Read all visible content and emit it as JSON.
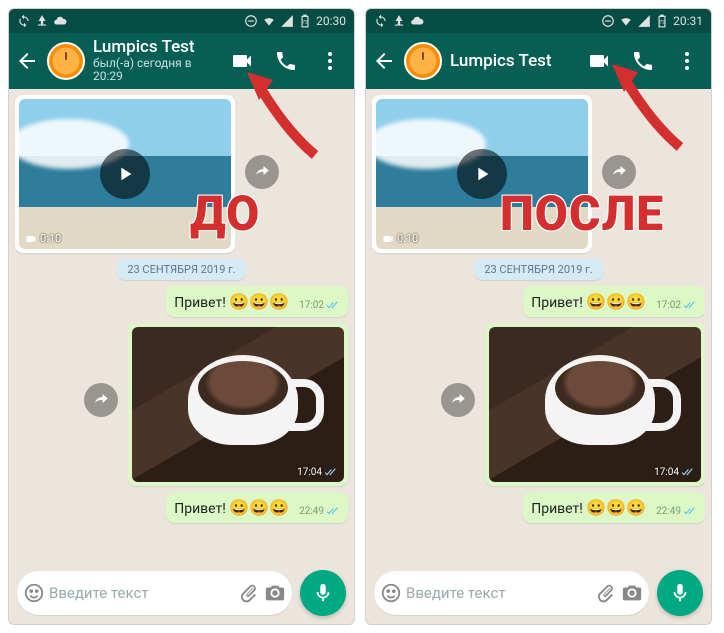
{
  "left": {
    "status_time": "20:30",
    "contact_name": "Lumpics Test",
    "last_seen": "был(-а) сегодня в 20:29",
    "overlay_label": "ДО",
    "video_duration": "0:10",
    "date_chip": "23 СЕНТЯБРЯ 2019 г.",
    "msg1_text": "Привет!",
    "msg1_emojis": "😀😀😀",
    "msg1_time": "17:02",
    "img_time": "17:04",
    "msg2_text": "Привет!",
    "msg2_emojis": "😀😀😀",
    "msg2_time": "22:49",
    "input_placeholder": "Введите текст"
  },
  "right": {
    "status_time": "20:31",
    "contact_name": "Lumpics Test",
    "last_seen": "",
    "overlay_label": "ПОСЛЕ",
    "video_duration": "0:10",
    "date_chip": "23 СЕНТЯБРЯ 2019 г.",
    "msg1_text": "Привет!",
    "msg1_emojis": "😀😀😀",
    "msg1_time": "17:02",
    "img_time": "17:04",
    "msg2_text": "Привет!",
    "msg2_emojis": "😀😀😀",
    "msg2_time": "22:49",
    "input_placeholder": "Введите текст"
  },
  "icons": {
    "back": "back-icon",
    "video_call": "video-call-icon",
    "voice_call": "phone-icon",
    "menu": "more-vert-icon",
    "emoji": "emoji-icon",
    "attach": "attach-icon",
    "camera": "camera-icon",
    "mic": "mic-icon",
    "play": "play-icon",
    "forward": "forward-icon",
    "camcorder": "camcorder-icon"
  }
}
